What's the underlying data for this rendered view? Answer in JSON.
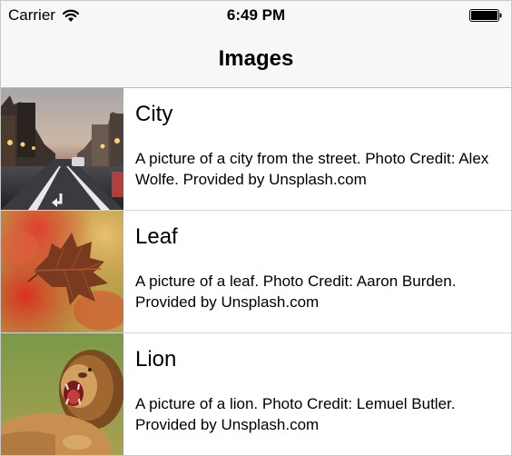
{
  "status_bar": {
    "carrier": "Carrier",
    "time": "6:49 PM",
    "wifi_icon": "wifi-icon",
    "battery_icon": "battery-icon"
  },
  "nav": {
    "title": "Images"
  },
  "list": {
    "items": [
      {
        "title": "City",
        "description": "A picture of a city from the street. Photo Credit: Alex Wolfe. Provided by Unsplash.com",
        "image": "city-street-photo"
      },
      {
        "title": "Leaf",
        "description": "A picture of a leaf. Photo Credit: Aaron Burden. Provided by Unsplash.com",
        "image": "autumn-leaf-photo"
      },
      {
        "title": "Lion",
        "description": "A picture of a lion. Photo Credit: Lemuel Butler. Provided by Unsplash.com",
        "image": "roaring-lion-photo"
      }
    ]
  }
}
